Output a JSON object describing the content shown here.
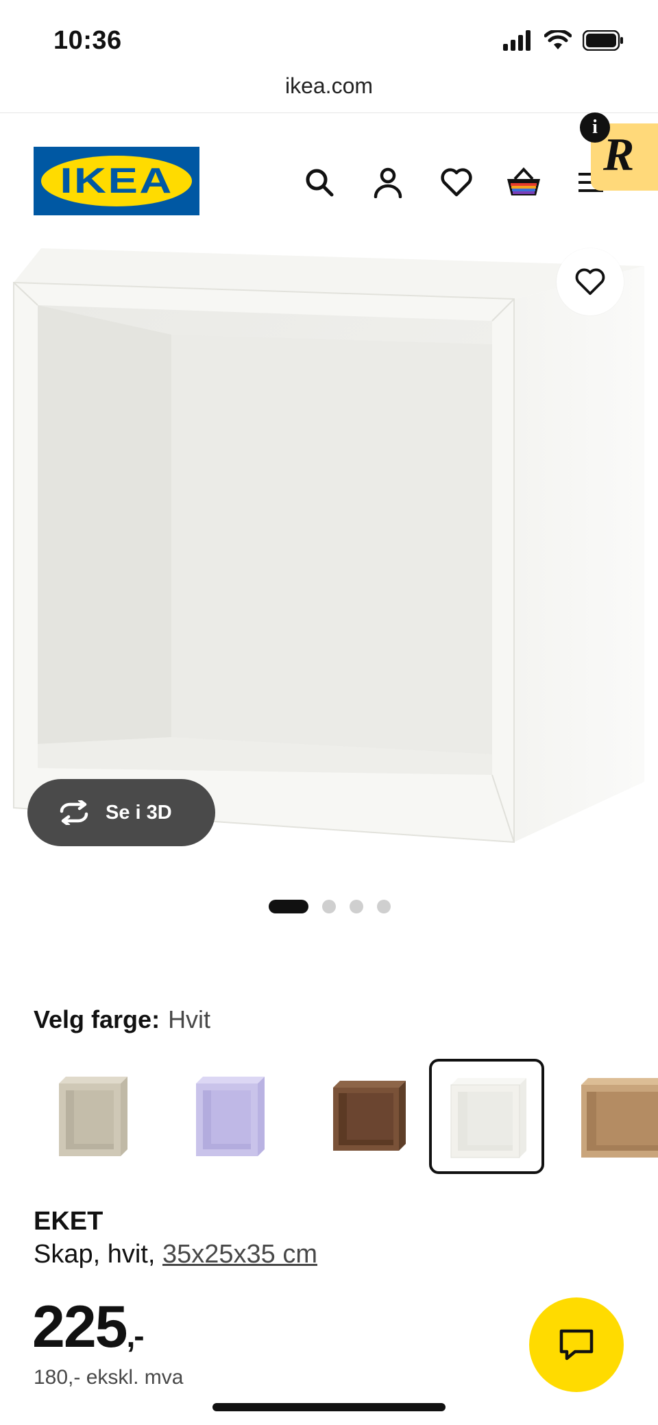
{
  "status_bar": {
    "time": "10:36"
  },
  "browser": {
    "url": "ikea.com"
  },
  "header": {
    "logo_text": "IKEA",
    "icons": [
      "search-icon",
      "account-icon",
      "heart-icon",
      "basket-icon",
      "menu-icon"
    ],
    "extension_info": "i",
    "extension_letter": "R"
  },
  "gallery": {
    "view_3d_label": "Se i 3D",
    "page_count": 4,
    "active_index": 0
  },
  "color_picker": {
    "label": "Velg farge:",
    "selected_value": "Hvit",
    "options": [
      {
        "name": "beige",
        "color": "#cfc8b6"
      },
      {
        "name": "lilla",
        "color": "#c9c3ea"
      },
      {
        "name": "valnøtt",
        "color": "#7a5238"
      },
      {
        "name": "hvit",
        "color": "#f2f1ec",
        "selected": true
      },
      {
        "name": "eik",
        "color": "#c9a57c"
      }
    ]
  },
  "product": {
    "name": "EKET",
    "description_prefix": "Skap, hvit, ",
    "dimensions": "35x25x35 cm",
    "price": "225",
    "price_suffix": ",-",
    "price_excl_vat": "180,- ekskl. mva"
  },
  "colors": {
    "brand_blue": "#0058a3",
    "brand_yellow": "#ffdb00",
    "dark_button": "#4a4a4a"
  }
}
